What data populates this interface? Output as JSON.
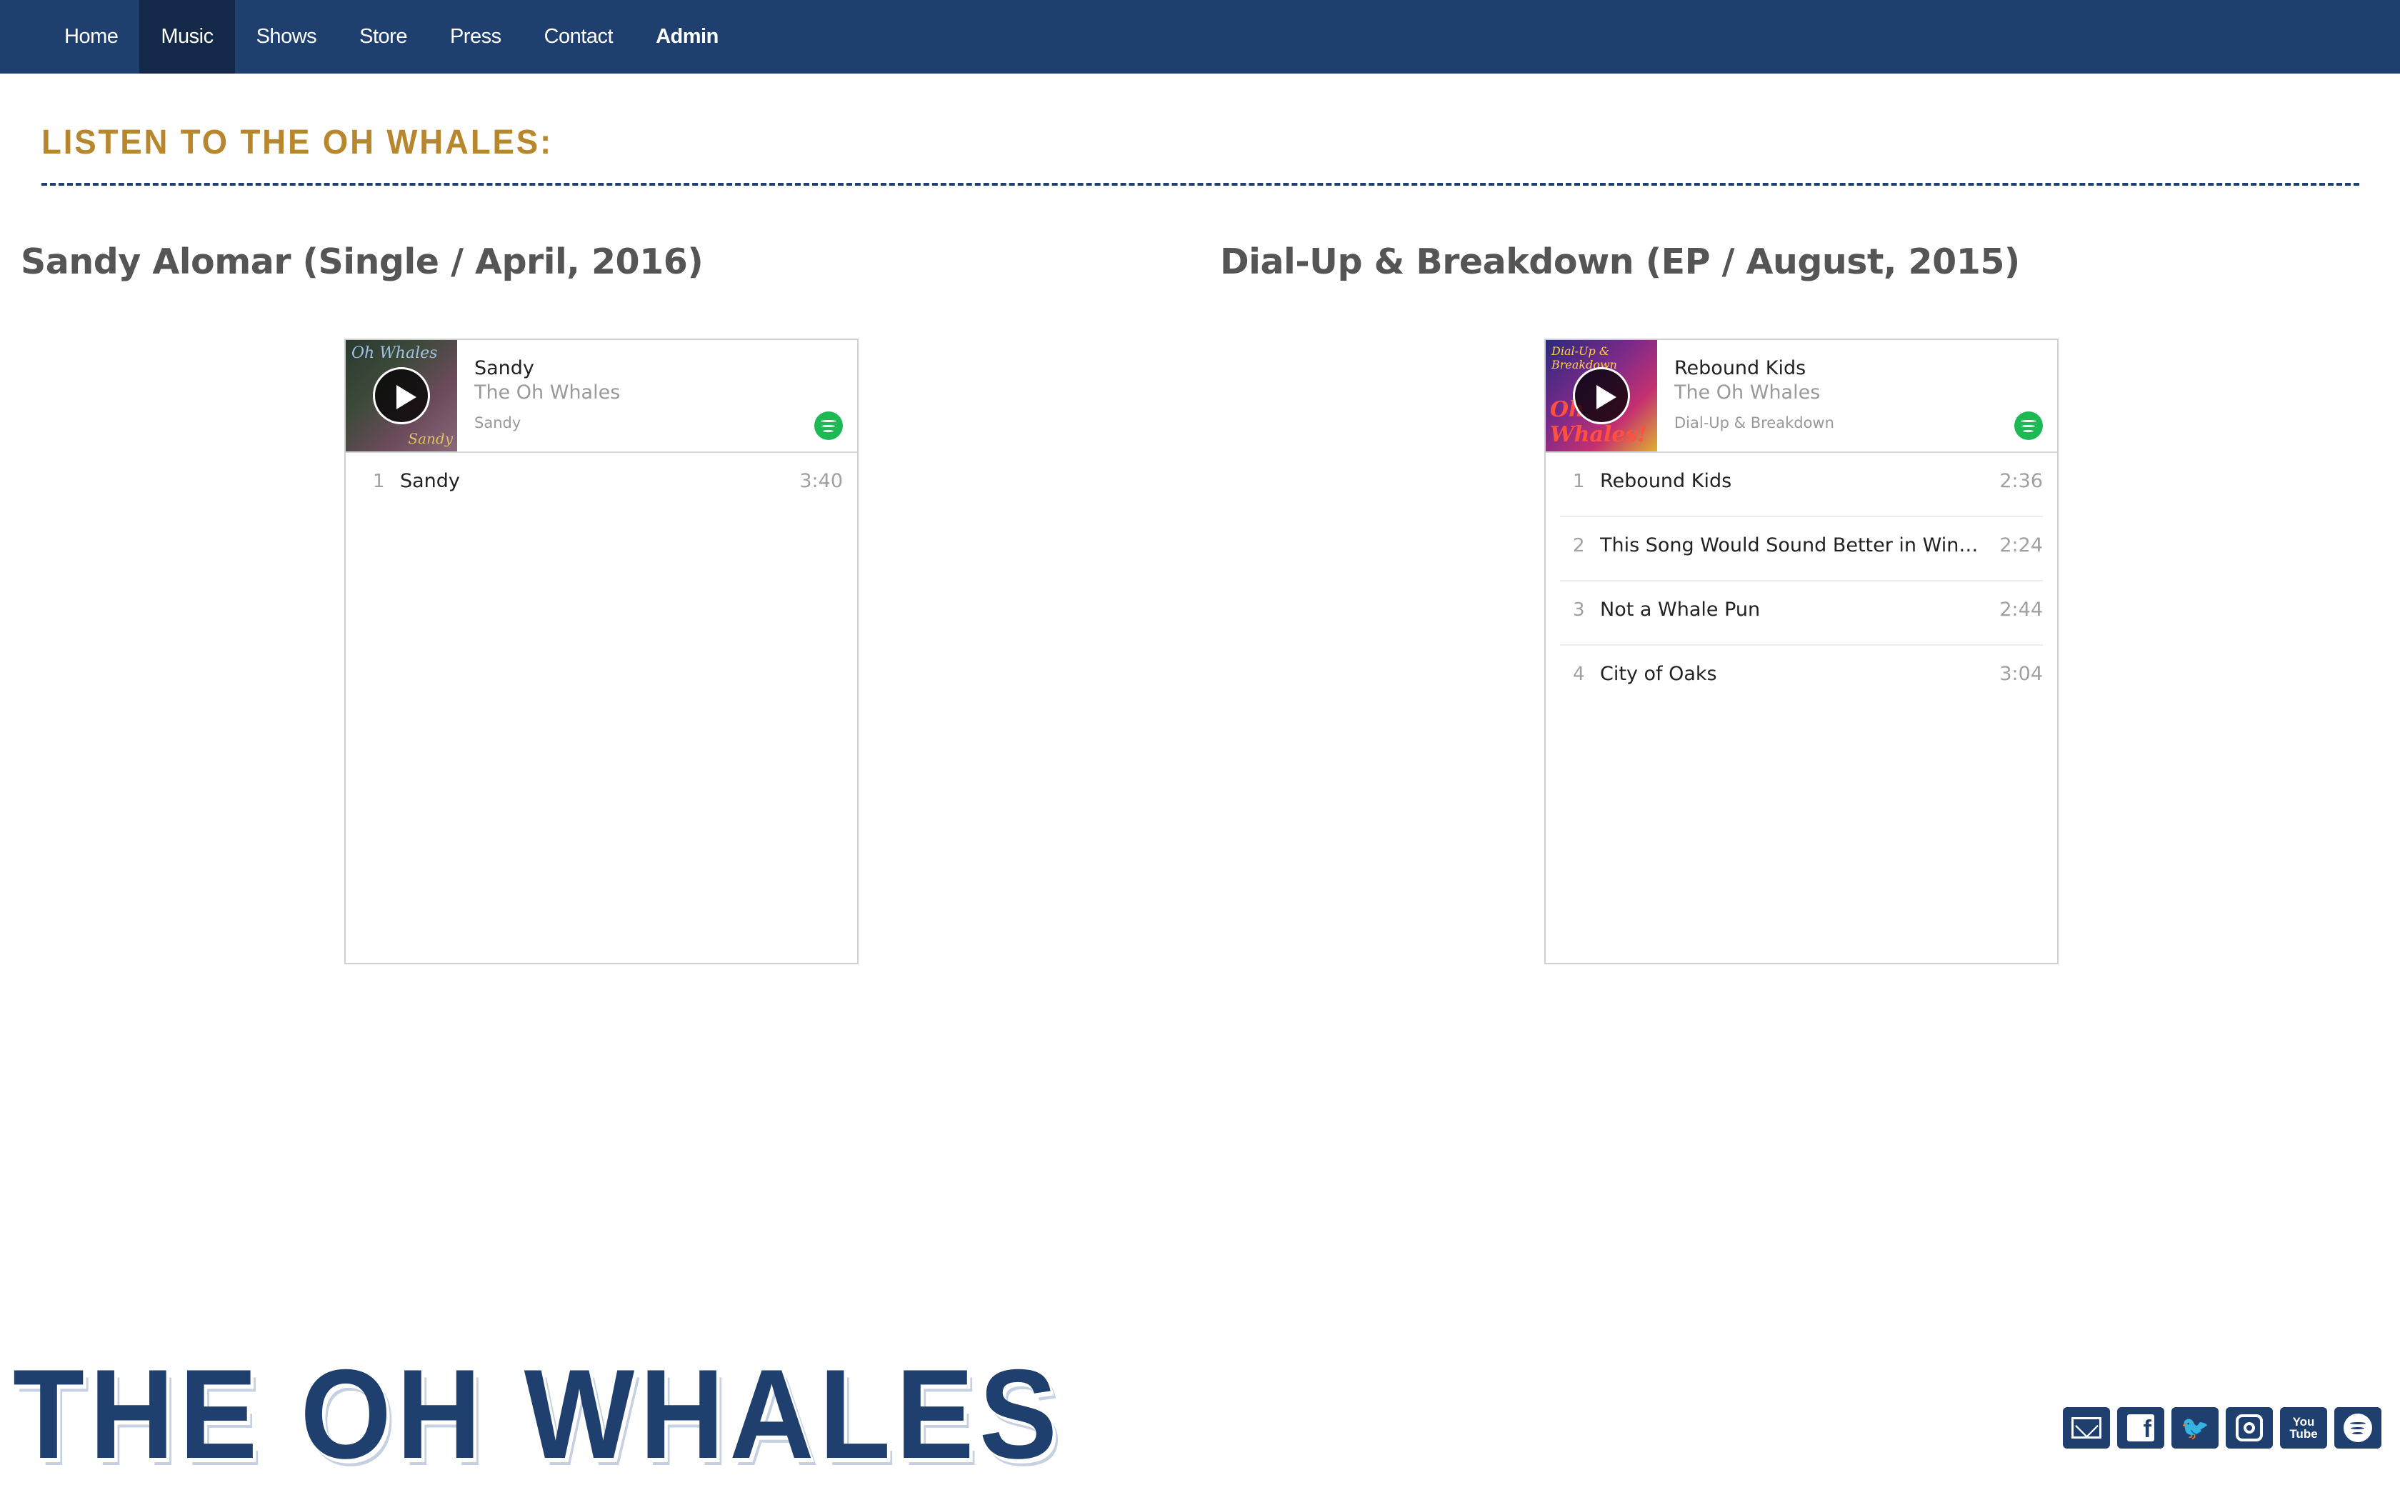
{
  "nav": {
    "items": [
      {
        "label": "Home"
      },
      {
        "label": "Music"
      },
      {
        "label": "Shows"
      },
      {
        "label": "Store"
      },
      {
        "label": "Press"
      },
      {
        "label": "Contact"
      },
      {
        "label": "Admin"
      }
    ],
    "active": "Music"
  },
  "page": {
    "heading": "Listen to the Oh Whales:"
  },
  "releases": [
    {
      "title": "Sandy Alomar (Single / April, 2016)",
      "player": {
        "cover_text": "Oh Whales",
        "cover_sub": "Sandy",
        "track": "Sandy",
        "artist": "The Oh Whales",
        "album": "Sandy",
        "tracks": [
          {
            "num": "1",
            "title": "Sandy",
            "duration": "3:40"
          }
        ]
      }
    },
    {
      "title": "Dial-Up & Breakdown (EP / August, 2015)",
      "player": {
        "cover_text": "Dial-Up & Breakdown",
        "cover_sub": "Oh Whales!",
        "track": "Rebound Kids",
        "artist": "The Oh Whales",
        "album": "Dial-Up & Breakdown",
        "tracks": [
          {
            "num": "1",
            "title": "Rebound Kids",
            "duration": "2:36"
          },
          {
            "num": "2",
            "title": "This Song Would Sound Better in Wingdin...",
            "duration": "2:24"
          },
          {
            "num": "3",
            "title": "Not a Whale Pun",
            "duration": "2:44"
          },
          {
            "num": "4",
            "title": "City of Oaks",
            "duration": "3:04"
          }
        ]
      }
    }
  ],
  "footer": {
    "logo": "THE OH WHALES",
    "social": [
      {
        "icon": "email-icon"
      },
      {
        "icon": "facebook-icon",
        "glyph": "f"
      },
      {
        "icon": "twitter-icon",
        "glyph": "🐦"
      },
      {
        "icon": "instagram-icon"
      },
      {
        "icon": "youtube-icon",
        "glyph_top": "You",
        "glyph_bottom": "Tube"
      },
      {
        "icon": "spotify-icon"
      }
    ]
  },
  "colors": {
    "nav_bg": "#1f3f6e",
    "nav_active": "#14284a",
    "heading": "#b8862d",
    "spotify": "#1db954"
  }
}
